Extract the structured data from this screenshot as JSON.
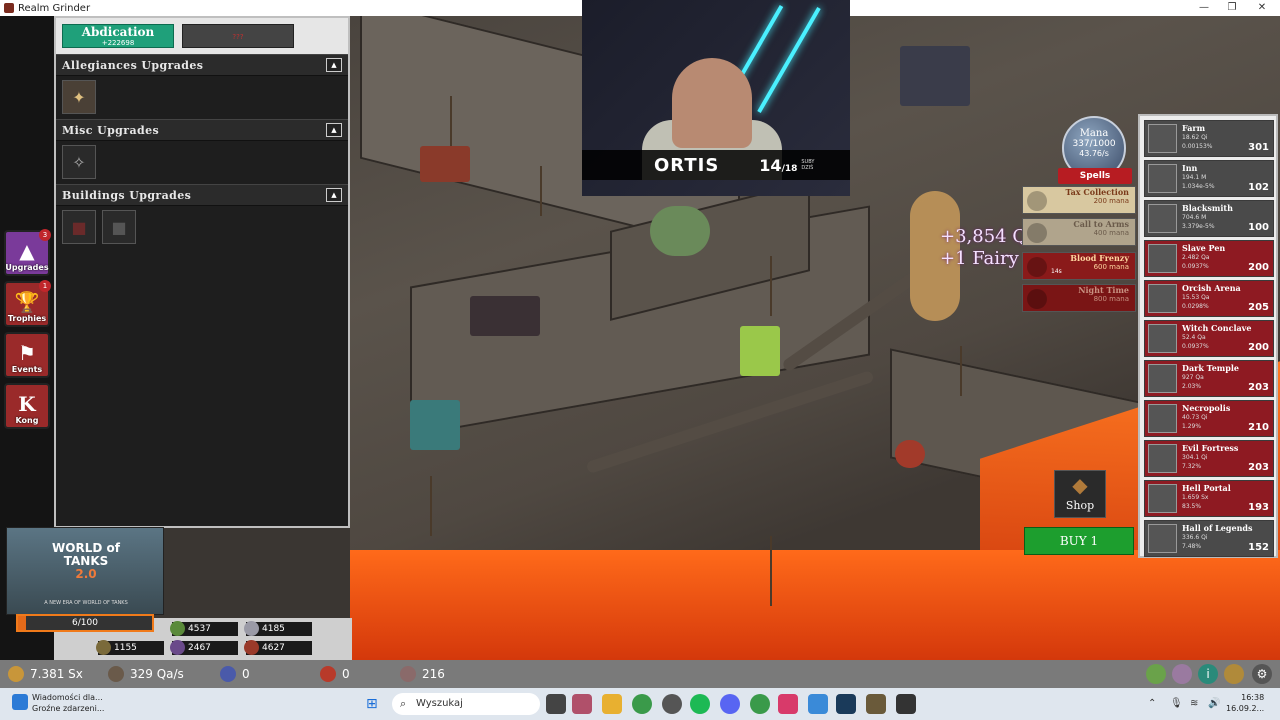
{
  "window": {
    "title": "Realm Grinder",
    "minimize_icon": "minimize-icon",
    "maximize_icon": "maximize-icon",
    "close_icon": "close-icon"
  },
  "rail": {
    "items": [
      {
        "label": "Upgrades",
        "badge": "3",
        "icon": "upgrades-icon",
        "color": "#7a3a9a"
      },
      {
        "label": "Trophies",
        "badge": "1",
        "icon": "trophy-icon",
        "color": "#9a2a2a"
      },
      {
        "label": "Events",
        "badge": "",
        "icon": "flag-icon",
        "color": "#9a2a2a"
      },
      {
        "label": "Kong",
        "badge": "",
        "icon": "kong-icon",
        "color": "#9a2a2a"
      }
    ]
  },
  "panel": {
    "abdication": {
      "label": "Abdication",
      "sub": "+222698"
    },
    "red_button_label": "???",
    "sections": [
      {
        "title": "Allegiances Upgrades",
        "collapse": "▲"
      },
      {
        "title": "Misc Upgrades",
        "collapse": "▲"
      },
      {
        "title": "Buildings Upgrades",
        "collapse": "▲"
      }
    ]
  },
  "ad": {
    "title": "WORLD of TANKS",
    "version": "2.0",
    "tagline": "A NEW ERA OF WORLD OF TANKS"
  },
  "resources_left": {
    "progress_text": "6/100",
    "progress": 0.06,
    "values": [
      "4537",
      "4185",
      "1155",
      "2467",
      "4627"
    ]
  },
  "stream": {
    "name": "ORTIS",
    "sub_count": "14",
    "sub_total": "/18",
    "sub_label": "SUBY DZIŚ"
  },
  "mana": {
    "label": "Mana",
    "value": "337/1000",
    "rate": "43.76/s",
    "spells_label": "Spells"
  },
  "spells": [
    {
      "name": "Tax Collection",
      "cost": "200 mana",
      "bg": "#d8c8a0",
      "color": "#7a3a1a"
    },
    {
      "name": "Call to Arms",
      "cost": "400 mana",
      "bg": "#b0a48c",
      "color": "#6a5a4a"
    },
    {
      "name": "Blood Frenzy",
      "cost": "600 mana",
      "bg": "#8a1a1a",
      "color": "#ffd6a0",
      "timer": "14s"
    },
    {
      "name": "Night Time",
      "cost": "800 mana",
      "bg": "#7a1515",
      "color": "#c89080"
    }
  ],
  "floating_text": [
    "+3,854 Q",
    "+1 Fairy"
  ],
  "buildings": [
    {
      "name": "Farm",
      "v1": "18.62 Qi",
      "v2": "0.00153%",
      "count": "301",
      "bg": "#4a4a4a"
    },
    {
      "name": "Inn",
      "v1": "194.1 M",
      "v2": "1.034e-5%",
      "count": "102",
      "bg": "#4a4a4a"
    },
    {
      "name": "Blacksmith",
      "v1": "704.6 M",
      "v2": "3.379e-5%",
      "count": "100",
      "bg": "#4a4a4a"
    },
    {
      "name": "Slave Pen",
      "v1": "2.482 Qa",
      "v2": "0.0937%",
      "count": "200",
      "bg": "#8e1a22"
    },
    {
      "name": "Orcish Arena",
      "v1": "15.53 Qa",
      "v2": "0.0298%",
      "count": "205",
      "bg": "#8e1a22"
    },
    {
      "name": "Witch Conclave",
      "v1": "52.4 Qa",
      "v2": "0.0937%",
      "count": "200",
      "bg": "#8e1a22"
    },
    {
      "name": "Dark Temple",
      "v1": "927 Qa",
      "v2": "2.03%",
      "count": "203",
      "bg": "#8e1a22"
    },
    {
      "name": "Necropolis",
      "v1": "40.73 Qi",
      "v2": "1.29%",
      "count": "210",
      "bg": "#8e1a22"
    },
    {
      "name": "Evil Fortress",
      "v1": "304.1 Qi",
      "v2": "7.32%",
      "count": "203",
      "bg": "#8e1a22"
    },
    {
      "name": "Hell Portal",
      "v1": "1.659 Sx",
      "v2": "83.5%",
      "count": "193",
      "bg": "#8e1a22"
    },
    {
      "name": "Hall of Legends",
      "v1": "336.6 Qi",
      "v2": "7.48%",
      "count": "152",
      "bg": "#4a4a4a"
    }
  ],
  "shop_label": "Shop",
  "buy_label": "BUY 1",
  "statusbar": {
    "gold": "7.381 Sx",
    "rate": "329 Qa/s",
    "gems": "0",
    "rubies": "0",
    "units": "216"
  },
  "taskbar": {
    "news_title": "Wiadomości dla...",
    "news_sub": "Groźne zdarzeni...",
    "search_placeholder": "Wyszukaj",
    "time": "16:38",
    "date": "16.09.2..."
  }
}
